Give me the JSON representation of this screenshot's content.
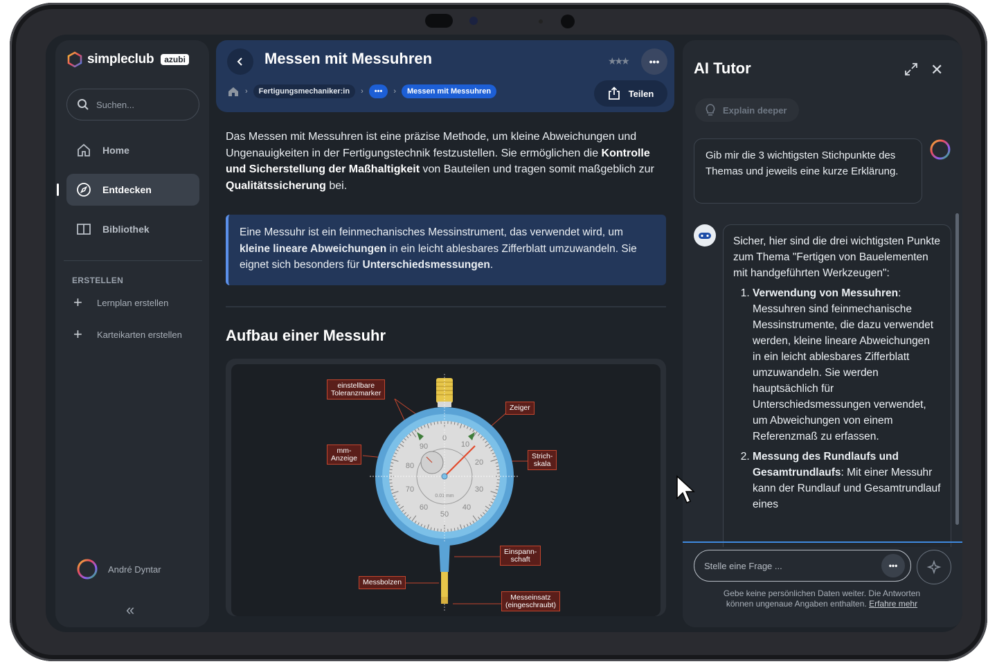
{
  "brand": {
    "name": "simpleclub",
    "badge": "azubi"
  },
  "sidebar": {
    "search_placeholder": "Suchen...",
    "items": [
      {
        "label": "Home",
        "icon": "home-icon"
      },
      {
        "label": "Entdecken",
        "icon": "compass-icon",
        "active": true
      },
      {
        "label": "Bibliothek",
        "icon": "book-icon"
      }
    ],
    "section_label": "ERSTELLEN",
    "create_items": [
      {
        "label": "Lernplan erstellen",
        "icon": "plus-icon"
      },
      {
        "label": "Karteikarten erstellen",
        "icon": "plus-icon"
      }
    ],
    "user_name": "André Dyntar",
    "collapse_glyph": "«"
  },
  "main": {
    "title": "Messen mit Messuhren",
    "breadcrumb": [
      "Fertigungsmechaniker:in",
      "•••",
      "Messen mit Messuhren"
    ],
    "share_label": "Teilen",
    "intro_parts": [
      "Das Messen mit Messuhren ist eine präzise Methode, um kleine Abweichungen und Ungenauigkeiten in der Fertigungstechnik festzustellen. Sie ermöglichen die ",
      "Kontrolle und Sicherstellung der Maßhaltigkeit",
      " von Bauteilen und tragen somit maßgeblich zur ",
      "Qualitätssicherung",
      " bei."
    ],
    "callout_parts": [
      "Eine Messuhr ist ein feinmechanisches Messinstrument, das verwendet wird, um ",
      "kleine lineare Abweichungen",
      " in ein leicht ablesbares Zifferblatt umzuwandeln. Sie eignet sich besonders für ",
      "Unterschiedsmessungen",
      "."
    ],
    "section_title": "Aufbau einer Messuhr",
    "figure": {
      "labels": {
        "toleranz": [
          "einstellbare",
          "Toleranzmarker"
        ],
        "zeiger": "Zeiger",
        "mm": [
          "mm-",
          "Anzeige"
        ],
        "strich": [
          "Strich-",
          "skala"
        ],
        "einspann": [
          "Einspann-",
          "schaft"
        ],
        "messbolzen": "Messbolzen",
        "messeinsatz": [
          "Messeinsatz",
          "(eingeschraubt)"
        ]
      },
      "dial_numbers": [
        "0",
        "10",
        "20",
        "30",
        "40",
        "50",
        "60",
        "70",
        "80",
        "90"
      ],
      "unit": "0.01 mm"
    }
  },
  "tutor": {
    "title": "AI Tutor",
    "explain_label": "Explain deeper",
    "user_message": "Gib mir die 3 wichtigsten Stichpunkte des Themas und jeweils eine kurze Erklärung.",
    "bot_intro": "Sicher, hier sind die drei wichtigsten Punkte zum Thema \"Fertigen von Bauelementen mit handgeführten Werkzeugen\":",
    "points": [
      {
        "title": "Verwendung von Messuhren",
        "text": ": Messuhren sind feinmechanische Messinstrumente, die dazu verwendet werden, kleine lineare Abweichungen in ein leicht ablesbares Zifferblatt umzuwandeln. Sie werden hauptsächlich für Unterschiedsmessungen verwendet, um Abweichungen von einem Referenzmaß zu erfassen."
      },
      {
        "title": "Messung des Rundlaufs und Gesamtrundlaufs",
        "text": ": Mit einer Messuhr kann der Rundlauf und Gesamtrundlauf eines"
      }
    ],
    "input_placeholder": "Stelle eine Frage ...",
    "disclaimer": "Gebe keine persönlichen Daten weiter. Die Antworten können ungenaue Angaben enthalten.",
    "learn_more": "Erfahre mehr"
  }
}
